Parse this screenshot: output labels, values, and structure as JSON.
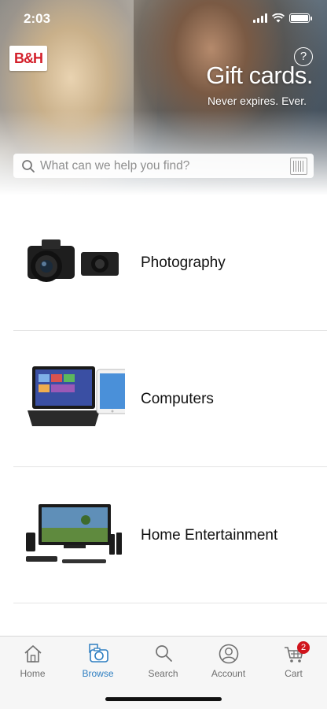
{
  "status_bar": {
    "time": "2:03"
  },
  "hero": {
    "brand_logo": "B&H",
    "promo_title": "Gift cards.",
    "promo_subtitle": "Never expires. Ever.",
    "help_icon": "question-circle-icon"
  },
  "search": {
    "placeholder": "What can we help you find?"
  },
  "categories": [
    {
      "label": "Photography",
      "icon": "camera-product-thumbnail"
    },
    {
      "label": "Computers",
      "icon": "laptop-tablet-product-thumbnail"
    },
    {
      "label": "Home Entertainment",
      "icon": "tv-speakers-product-thumbnail"
    }
  ],
  "tabbar": {
    "items": [
      {
        "label": "Home",
        "icon": "home-icon",
        "active": false
      },
      {
        "label": "Browse",
        "icon": "browse-camera-icon",
        "active": true
      },
      {
        "label": "Search",
        "icon": "search-icon",
        "active": false
      },
      {
        "label": "Account",
        "icon": "account-icon",
        "active": false
      },
      {
        "label": "Cart",
        "icon": "cart-icon",
        "active": false,
        "badge": "2"
      }
    ]
  },
  "colors": {
    "accent": "#2f7fc1",
    "badge": "#d0141c",
    "brand_red": "#d31f2a"
  }
}
